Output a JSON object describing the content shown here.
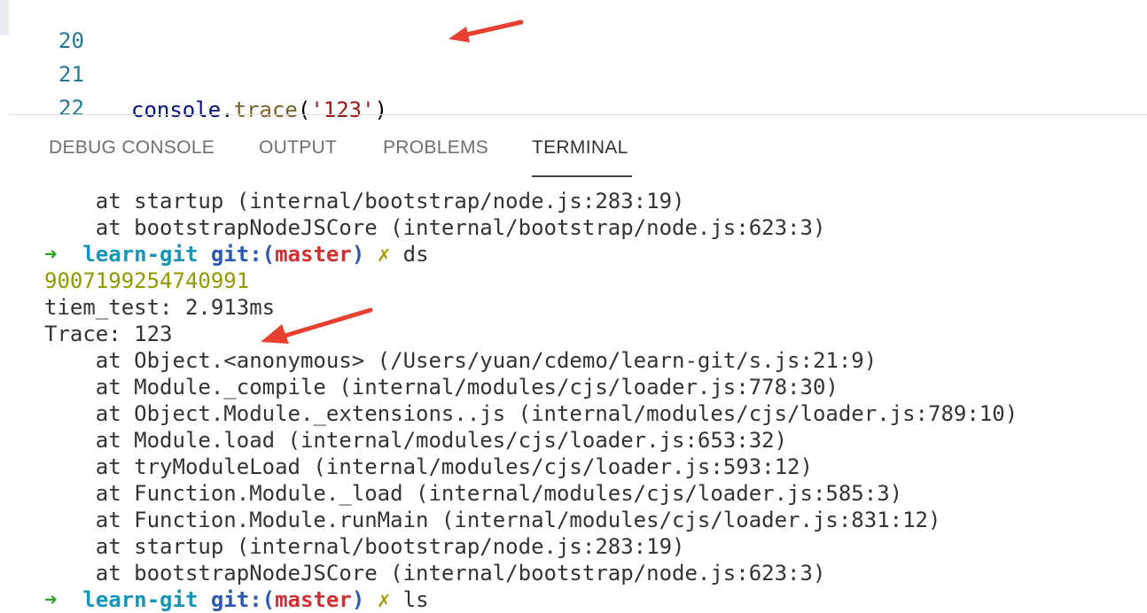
{
  "editor": {
    "lines": [
      {
        "number": "20"
      },
      {
        "number": "21",
        "obj": "console",
        "dot": ".",
        "fn": "trace",
        "open": "(",
        "str": "'123'",
        "close": ")"
      },
      {
        "number": "22"
      }
    ]
  },
  "panel": {
    "tabs": [
      {
        "label": "DEBUG CONSOLE"
      },
      {
        "label": "OUTPUT"
      },
      {
        "label": "PROBLEMS"
      },
      {
        "label": "TERMINAL",
        "active": true
      }
    ]
  },
  "terminal": {
    "top_lines": [
      "    at startup (internal/bootstrap/node.js:283:19)",
      "    at bootstrapNodeJSCore (internal/bootstrap/node.js:623:3)"
    ],
    "prompt1": {
      "arrow": "➜",
      "dir": "learn-git",
      "git": "git:",
      "paren_open": "(",
      "branch": "master",
      "paren_close": ")",
      "mark": "✗",
      "cmd": "ds"
    },
    "number_output": "9007199254740991",
    "timer_line": "tiem_test: 2.913ms",
    "trace_line": "Trace: 123",
    "stack": [
      "    at Object.<anonymous> (/Users/yuan/cdemo/learn-git/s.js:21:9)",
      "    at Module._compile (internal/modules/cjs/loader.js:778:30)",
      "    at Object.Module._extensions..js (internal/modules/cjs/loader.js:789:10)",
      "    at Module.load (internal/modules/cjs/loader.js:653:32)",
      "    at tryModuleLoad (internal/modules/cjs/loader.js:593:12)",
      "    at Function.Module._load (internal/modules/cjs/loader.js:585:3)",
      "    at Function.Module.runMain (internal/modules/cjs/loader.js:831:12)",
      "    at startup (internal/bootstrap/node.js:283:19)",
      "    at bootstrapNodeJSCore (internal/bootstrap/node.js:623:3)"
    ],
    "prompt2": {
      "arrow": "➜",
      "dir": "learn-git",
      "git": "git:",
      "paren_open": "(",
      "branch": "master",
      "paren_close": ")",
      "mark": "✗",
      "cmd": "ls"
    }
  },
  "colors": {
    "annotation_arrow": "#e8402f",
    "prompt_arrow": "#23a620",
    "dir": "#1596b8",
    "git": "#2c58b8",
    "branch": "#cd3131",
    "dirty_mark": "#a69c00",
    "number_output": "#949800"
  }
}
